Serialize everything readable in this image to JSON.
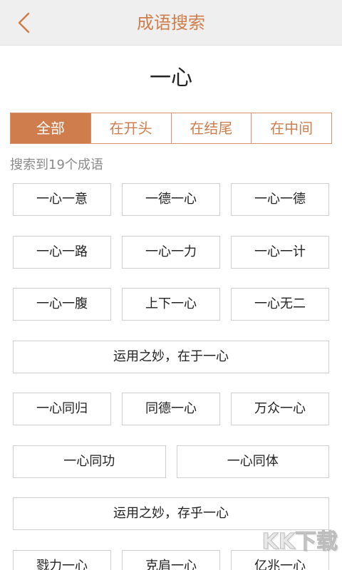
{
  "header": {
    "title": "成语搜索",
    "back_icon": "chevron-left-icon"
  },
  "query": "一心",
  "tabs": [
    {
      "label": "全部",
      "selected": true
    },
    {
      "label": "在开头",
      "selected": false
    },
    {
      "label": "在结尾",
      "selected": false
    },
    {
      "label": "在中间",
      "selected": false
    }
  ],
  "result_count_text": "搜索到19个成语",
  "idioms": [
    "一心一意",
    "一德一心",
    "一心一德",
    "一心一路",
    "一心一力",
    "一心一计",
    "一心一腹",
    "上下一心",
    "一心无二",
    "运用之妙，在于一心",
    "一心同归",
    "同德一心",
    "万众一心",
    "一心同功",
    "一心同体",
    "运用之妙，存乎一心",
    "戮力一心",
    "克肩一心",
    "亿兆一心"
  ],
  "watermark": "KK下载",
  "theme": {
    "accent": "#cf7d4c",
    "accent_border": "#d8916a",
    "header_bg": "#efefef",
    "chip_border": "#cfcfcf"
  }
}
